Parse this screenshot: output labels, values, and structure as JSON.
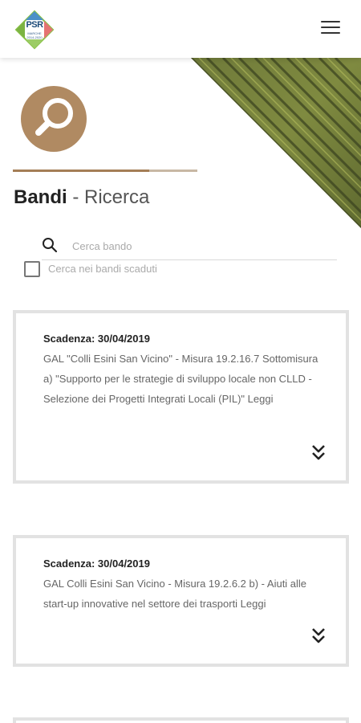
{
  "header": {
    "logo": {
      "text": "PSR",
      "subtext": "MARCHE\n2014-2020",
      "icon": "psr-marche-logo"
    },
    "menu_icon": "hamburger-menu-icon"
  },
  "hero": {
    "icon": "search-icon",
    "image": "vineyard-photo"
  },
  "page_title": {
    "strong": "Bandi",
    "separator": " - ",
    "light": "Ricerca"
  },
  "search": {
    "placeholder": "Cerca bando",
    "value": "",
    "icon": "search-icon"
  },
  "expired_filter": {
    "label": "Cerca nei bandi scaduti",
    "checked": false
  },
  "cards": [
    {
      "deadline": "Scadenza: 30/04/2019",
      "description": "GAL \"Colli Esini San Vicino\" - Misura 19.2.16.7 Sottomisura a) \"Supporto per le strategie di sviluppo locale non CLLD - Selezione dei Progetti Integrati Locali (PIL)\" Leggi",
      "expand_icon": "double-chevron-down-icon"
    },
    {
      "deadline": "Scadenza: 30/04/2019",
      "description": "GAL Colli Esini San Vicino - Misura 19.2.6.2 b) - Aiuti alle start-up innovative nel settore dei trasporti Leggi",
      "expand_icon": "double-chevron-down-icon"
    }
  ],
  "colors": {
    "accent": "#b08a62",
    "accent_dark": "#a47e56",
    "card_border": "#e2e2e2"
  }
}
